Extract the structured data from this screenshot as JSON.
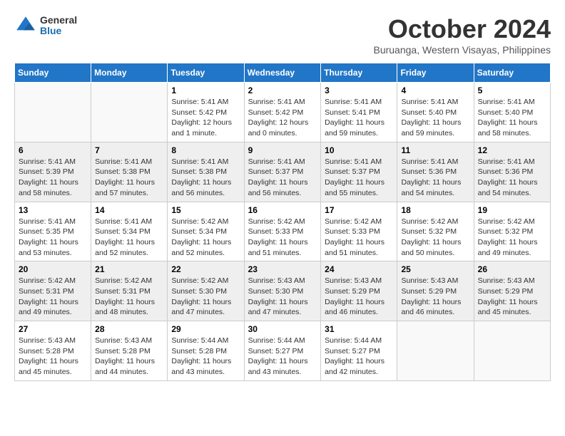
{
  "header": {
    "logo_general": "General",
    "logo_blue": "Blue",
    "month_title": "October 2024",
    "location": "Buruanga, Western Visayas, Philippines"
  },
  "weekdays": [
    "Sunday",
    "Monday",
    "Tuesday",
    "Wednesday",
    "Thursday",
    "Friday",
    "Saturday"
  ],
  "rows": [
    [
      {
        "day": "",
        "info": ""
      },
      {
        "day": "",
        "info": ""
      },
      {
        "day": "1",
        "info": "Sunrise: 5:41 AM\nSunset: 5:42 PM\nDaylight: 12 hours and 1 minute."
      },
      {
        "day": "2",
        "info": "Sunrise: 5:41 AM\nSunset: 5:42 PM\nDaylight: 12 hours and 0 minutes."
      },
      {
        "day": "3",
        "info": "Sunrise: 5:41 AM\nSunset: 5:41 PM\nDaylight: 11 hours and 59 minutes."
      },
      {
        "day": "4",
        "info": "Sunrise: 5:41 AM\nSunset: 5:40 PM\nDaylight: 11 hours and 59 minutes."
      },
      {
        "day": "5",
        "info": "Sunrise: 5:41 AM\nSunset: 5:40 PM\nDaylight: 11 hours and 58 minutes."
      }
    ],
    [
      {
        "day": "6",
        "info": "Sunrise: 5:41 AM\nSunset: 5:39 PM\nDaylight: 11 hours and 58 minutes."
      },
      {
        "day": "7",
        "info": "Sunrise: 5:41 AM\nSunset: 5:38 PM\nDaylight: 11 hours and 57 minutes."
      },
      {
        "day": "8",
        "info": "Sunrise: 5:41 AM\nSunset: 5:38 PM\nDaylight: 11 hours and 56 minutes."
      },
      {
        "day": "9",
        "info": "Sunrise: 5:41 AM\nSunset: 5:37 PM\nDaylight: 11 hours and 56 minutes."
      },
      {
        "day": "10",
        "info": "Sunrise: 5:41 AM\nSunset: 5:37 PM\nDaylight: 11 hours and 55 minutes."
      },
      {
        "day": "11",
        "info": "Sunrise: 5:41 AM\nSunset: 5:36 PM\nDaylight: 11 hours and 54 minutes."
      },
      {
        "day": "12",
        "info": "Sunrise: 5:41 AM\nSunset: 5:36 PM\nDaylight: 11 hours and 54 minutes."
      }
    ],
    [
      {
        "day": "13",
        "info": "Sunrise: 5:41 AM\nSunset: 5:35 PM\nDaylight: 11 hours and 53 minutes."
      },
      {
        "day": "14",
        "info": "Sunrise: 5:41 AM\nSunset: 5:34 PM\nDaylight: 11 hours and 52 minutes."
      },
      {
        "day": "15",
        "info": "Sunrise: 5:42 AM\nSunset: 5:34 PM\nDaylight: 11 hours and 52 minutes."
      },
      {
        "day": "16",
        "info": "Sunrise: 5:42 AM\nSunset: 5:33 PM\nDaylight: 11 hours and 51 minutes."
      },
      {
        "day": "17",
        "info": "Sunrise: 5:42 AM\nSunset: 5:33 PM\nDaylight: 11 hours and 51 minutes."
      },
      {
        "day": "18",
        "info": "Sunrise: 5:42 AM\nSunset: 5:32 PM\nDaylight: 11 hours and 50 minutes."
      },
      {
        "day": "19",
        "info": "Sunrise: 5:42 AM\nSunset: 5:32 PM\nDaylight: 11 hours and 49 minutes."
      }
    ],
    [
      {
        "day": "20",
        "info": "Sunrise: 5:42 AM\nSunset: 5:31 PM\nDaylight: 11 hours and 49 minutes."
      },
      {
        "day": "21",
        "info": "Sunrise: 5:42 AM\nSunset: 5:31 PM\nDaylight: 11 hours and 48 minutes."
      },
      {
        "day": "22",
        "info": "Sunrise: 5:42 AM\nSunset: 5:30 PM\nDaylight: 11 hours and 47 minutes."
      },
      {
        "day": "23",
        "info": "Sunrise: 5:43 AM\nSunset: 5:30 PM\nDaylight: 11 hours and 47 minutes."
      },
      {
        "day": "24",
        "info": "Sunrise: 5:43 AM\nSunset: 5:29 PM\nDaylight: 11 hours and 46 minutes."
      },
      {
        "day": "25",
        "info": "Sunrise: 5:43 AM\nSunset: 5:29 PM\nDaylight: 11 hours and 46 minutes."
      },
      {
        "day": "26",
        "info": "Sunrise: 5:43 AM\nSunset: 5:29 PM\nDaylight: 11 hours and 45 minutes."
      }
    ],
    [
      {
        "day": "27",
        "info": "Sunrise: 5:43 AM\nSunset: 5:28 PM\nDaylight: 11 hours and 45 minutes."
      },
      {
        "day": "28",
        "info": "Sunrise: 5:43 AM\nSunset: 5:28 PM\nDaylight: 11 hours and 44 minutes."
      },
      {
        "day": "29",
        "info": "Sunrise: 5:44 AM\nSunset: 5:28 PM\nDaylight: 11 hours and 43 minutes."
      },
      {
        "day": "30",
        "info": "Sunrise: 5:44 AM\nSunset: 5:27 PM\nDaylight: 11 hours and 43 minutes."
      },
      {
        "day": "31",
        "info": "Sunrise: 5:44 AM\nSunset: 5:27 PM\nDaylight: 11 hours and 42 minutes."
      },
      {
        "day": "",
        "info": ""
      },
      {
        "day": "",
        "info": ""
      }
    ]
  ]
}
